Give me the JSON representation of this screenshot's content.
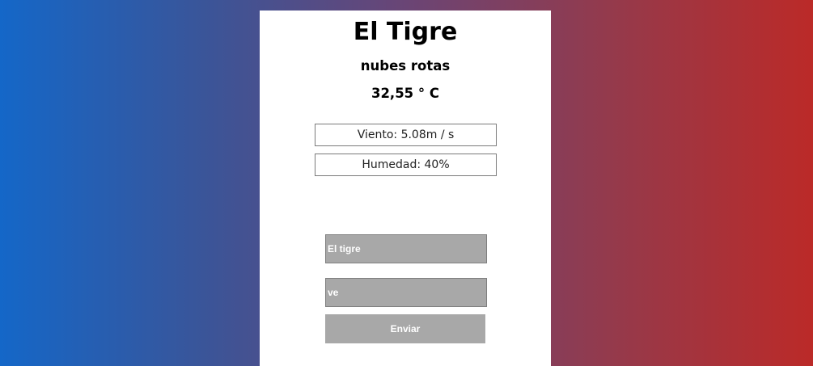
{
  "weather": {
    "city": "El Tigre",
    "description": "nubes rotas",
    "temperature": "32,55 ° C",
    "wind": "Viento: 5.08m / s",
    "humidity": "Humedad: 40%"
  },
  "form": {
    "city_value": "El tigre",
    "country_value": "ve",
    "submit_label": "Enviar"
  },
  "colors": {
    "gradient_left": "#1467c8",
    "gradient_right": "#bb2a28",
    "card_background": "#ffffff",
    "field_background": "#a8a8a8"
  }
}
